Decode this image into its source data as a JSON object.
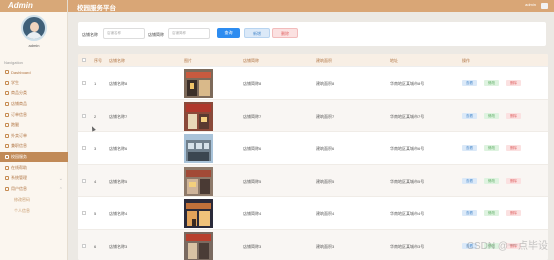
{
  "brand": "Admin",
  "username": "admin",
  "nav_heading": "Navigation",
  "menu": [
    {
      "label": "Dashboard",
      "active": false,
      "has_caret": false
    },
    {
      "label": "学生",
      "active": false,
      "has_caret": false
    },
    {
      "label": "商品分类",
      "active": false,
      "has_caret": false
    },
    {
      "label": "店铺商品",
      "active": false,
      "has_caret": false
    },
    {
      "label": "订单信息",
      "active": false,
      "has_caret": false
    },
    {
      "label": "跑腿",
      "active": false,
      "has_caret": false
    },
    {
      "label": "外卖订单",
      "active": false,
      "has_caret": false
    },
    {
      "label": "兼职信息",
      "active": false,
      "has_caret": false
    },
    {
      "label": "校园服务",
      "active": true,
      "has_caret": false
    },
    {
      "label": "在线帮助",
      "active": false,
      "has_caret": false
    },
    {
      "label": "系统管理",
      "active": false,
      "has_caret": true
    },
    {
      "label": "用户信息",
      "active": false,
      "has_caret": true
    }
  ],
  "submenu": [
    "修改密码",
    "个人信息"
  ],
  "topbar": {
    "title": "校园服务平台",
    "user": "admin"
  },
  "search": {
    "label1": "店铺名称",
    "placeholder1": "店铺名称",
    "label2": "店铺简称",
    "placeholder2": "店铺简称",
    "search_btn": "查询",
    "add_btn": "新增",
    "delete_btn": "删除"
  },
  "table": {
    "headers": [
      "序号",
      "店铺名称",
      "图片",
      "店铺简称",
      "建筑面积",
      "地址",
      "操作"
    ],
    "actions": {
      "detail": "查看",
      "edit": "修改",
      "delete": "删除"
    },
    "rows": [
      {
        "idx": "1",
        "name": "店铺名称8",
        "short": "店铺简称8",
        "area": "建筑面积8",
        "addr": "华南地区某城市8号"
      },
      {
        "idx": "2",
        "name": "店铺名称7",
        "short": "店铺简称7",
        "area": "建筑面积7",
        "addr": "华南地区某城市7号"
      },
      {
        "idx": "3",
        "name": "店铺名称6",
        "short": "店铺简称6",
        "area": "建筑面积6",
        "addr": "华南地区某城市6号"
      },
      {
        "idx": "4",
        "name": "店铺名称5",
        "short": "店铺简称5",
        "area": "建筑面积5",
        "addr": "华南地区某城市5号"
      },
      {
        "idx": "5",
        "name": "店铺名称4",
        "short": "店铺简称4",
        "area": "建筑面积4",
        "addr": "华南地区某城市4号"
      },
      {
        "idx": "6",
        "name": "店铺名称3",
        "short": "店铺简称3",
        "area": "建筑面积3",
        "addr": "华南地区某城市3号"
      }
    ]
  },
  "watermark": "CSDN @一点毕设",
  "colors": {
    "accent": "#d9a676",
    "active_menu": "#c18a57",
    "search_btn": "#2d8cf0"
  }
}
